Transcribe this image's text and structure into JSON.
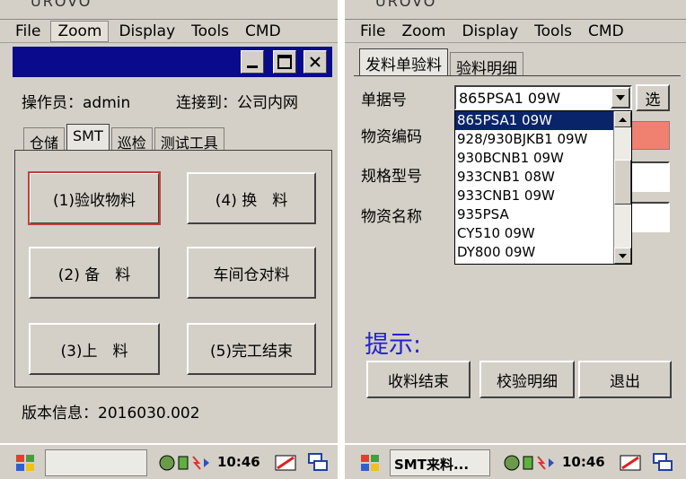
{
  "left": {
    "window_title": "UROVO",
    "menu": [
      "File",
      "Zoom",
      "Display",
      "Tools",
      "CMD"
    ],
    "operator": "操作员：admin",
    "connected": "连接到：公司内网",
    "tabs": [
      "仓储",
      "SMT",
      "巡检",
      "测试工具"
    ],
    "buttons": {
      "receive": "(1)验收物料",
      "change": "(4) 换　料",
      "prepare": "(2) 备　料",
      "workshop": "车间仓对料",
      "load": "(3)上　料",
      "finish": "(5)完工结束"
    },
    "version": "版本信息：2016030.002",
    "time": "10:46"
  },
  "right": {
    "window_title": "UROVO",
    "menu": [
      "File",
      "Zoom",
      "Display",
      "Tools",
      "CMD"
    ],
    "tabs": [
      "发料单验料",
      "验料明细"
    ],
    "labels": {
      "doc_no": "单据号",
      "material_code": "物资编码",
      "spec": "规格型号",
      "material_name": "物资名称"
    },
    "doc_no_value": "865PSA1 09W",
    "select_button": "选",
    "dropdown_options": [
      "865PSA1 09W",
      "928/930BJKB1 09W",
      "930BCNB1 09W",
      "933CNB1 08W",
      "933CNB1 09W",
      "935PSA",
      "CY510 09W",
      "DY800 09W"
    ],
    "selected_index": 0,
    "hint": "提示:",
    "buttons": {
      "finish_receive": "收料结束",
      "verify_detail": "校验明细",
      "exit": "退出"
    },
    "taskbar_app": "SMT来料...",
    "time": "10:46"
  },
  "colors": {
    "titlebar_blue": "#0a0a8c",
    "hint_blue": "#2222cc",
    "highlight_red": "#f08070",
    "selection_blue": "#0a246a"
  }
}
